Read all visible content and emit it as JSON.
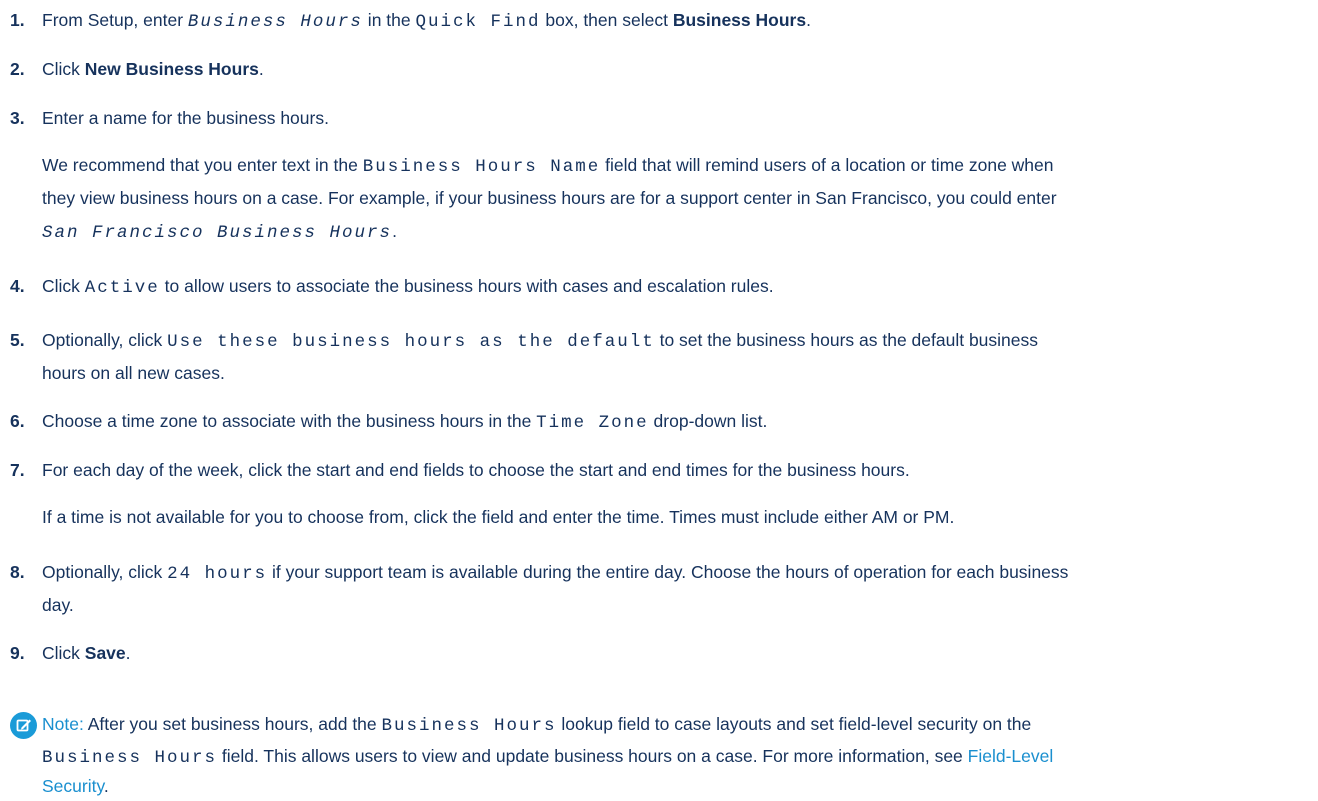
{
  "steps": [
    {
      "num": "1.",
      "t1": "From Setup, enter ",
      "code1": "Business Hours",
      "t2": " in the ",
      "code2": "Quick Find",
      "t3": " box, then select ",
      "bold": "Business Hours",
      "t4": "."
    },
    {
      "num": "2.",
      "t1": "Click ",
      "bold": "New Business Hours",
      "t2": "."
    },
    {
      "num": "3.",
      "t1": "Enter a name for the business hours.",
      "p1a": "We recommend that you enter text in the ",
      "p1code": "Business Hours Name",
      "p1b": " field that will remind users of a location or time zone when",
      "p2": "they view business hours on a case. For example, if your business hours are for a support center in San Francisco, you could enter",
      "p3code": "San Francisco Business Hours",
      "p3b": "."
    },
    {
      "num": "4.",
      "t1": "Click ",
      "code1": "Active",
      "t2": " to allow users to associate the business hours with cases and escalation rules."
    },
    {
      "num": "5.",
      "t1": "Optionally, click ",
      "code1": "Use these business hours as the default",
      "t2": " to set the business hours as the default business",
      "line2": "hours on all new cases."
    },
    {
      "num": "6.",
      "t1": "Choose a time zone to associate with the business hours in the ",
      "code1": "Time Zone",
      "t2": " drop-down list."
    },
    {
      "num": "7.",
      "t1": "For each day of the week, click the start and end fields to choose the start and end times for the business hours.",
      "para": "If a time is not available for you to choose from, click the field and enter the time. Times must include either AM or PM."
    },
    {
      "num": "8.",
      "t1": "Optionally, click ",
      "code1": "24 hours",
      "t2": " if your support team is available during the entire day. Choose the hours of operation for each business",
      "line2": "day."
    },
    {
      "num": "9.",
      "t1": "Click ",
      "bold": "Save",
      "t2": "."
    }
  ],
  "note": {
    "icon": "edit-note-icon",
    "label": "Note:",
    "t1": " After you set business hours, add the ",
    "code1": "Business Hours",
    "t2": " lookup field to case layouts and set field-level security on the",
    "code2": "Business Hours",
    "t3": " field. This allows users to view and update business hours on a case. For more information, see ",
    "link": "Field-Level",
    "link2": "Security",
    "t4": "."
  },
  "colors": {
    "text": "#16325c",
    "accent": "#1a9bd8"
  }
}
